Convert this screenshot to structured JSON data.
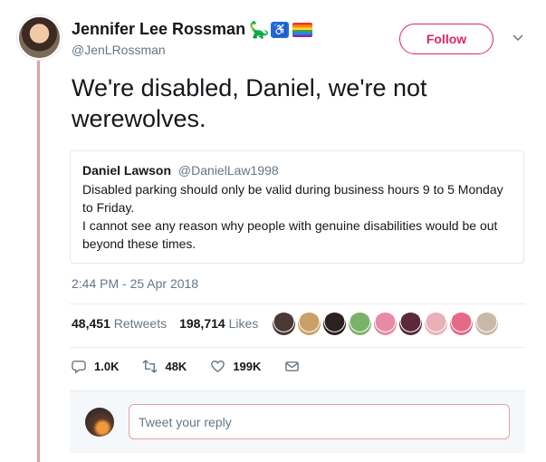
{
  "author": {
    "display_name": "Jennifer Lee Rossman",
    "handle": "@JenLRossman",
    "name_emojis": [
      "dinosaur",
      "wheelchair",
      "rainbow-flag"
    ]
  },
  "follow_label": "Follow",
  "tweet_text": "We're disabled, Daniel, we're not werewolves.",
  "quoted": {
    "name": "Daniel Lawson",
    "handle": "@DanielLaw1998",
    "line1": "Disabled parking should only be valid during business hours 9 to 5 Monday to Friday.",
    "line2": "I cannot see any reason why people with genuine disabilities would be out beyond these times."
  },
  "timestamp": "2:44 PM - 25 Apr 2018",
  "stats": {
    "retweets_count": "48,451",
    "retweets_label": "Retweets",
    "likes_count": "198,714",
    "likes_label": "Likes"
  },
  "liker_colors": [
    "#4a3a35",
    "#c9a067",
    "#2a2220",
    "#7bb26a",
    "#e78aa6",
    "#5a2a3a",
    "#e9b0b8",
    "#e46a8a",
    "#c9b9a8"
  ],
  "actions": {
    "replies": "1.0K",
    "retweets": "48K",
    "likes": "199K"
  },
  "reply": {
    "placeholder": "Tweet your reply"
  },
  "colors": {
    "accent": "#e0245e",
    "text": "#14171a",
    "muted": "#657786",
    "thread_line": "#e0a0a6"
  }
}
